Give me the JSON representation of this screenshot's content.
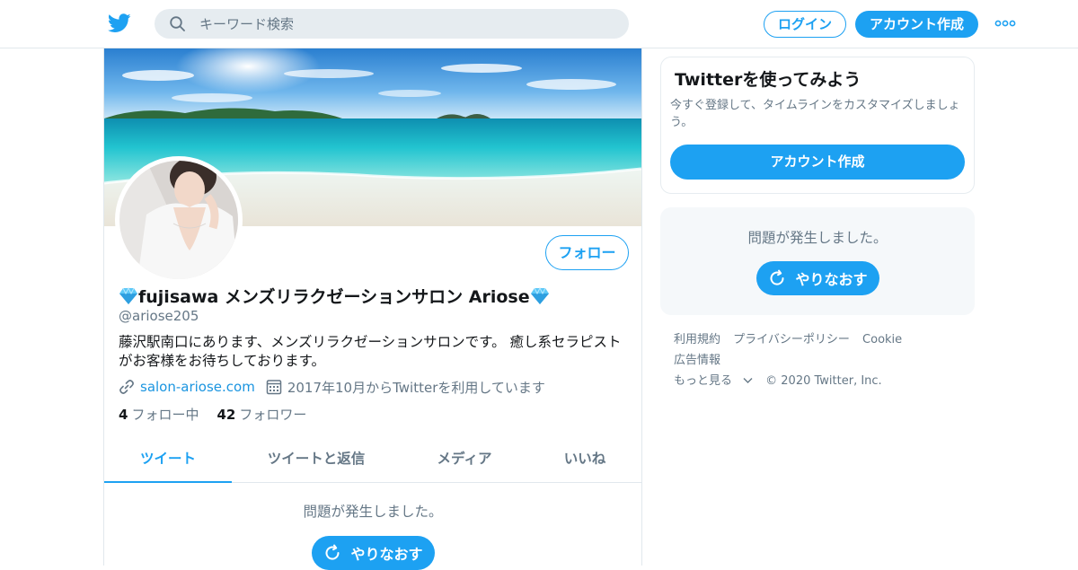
{
  "header": {
    "search_placeholder": "キーワード検索",
    "login_label": "ログイン",
    "signup_label": "アカウント作成"
  },
  "profile": {
    "display_name": "fujisawa メンズリラクゼーションサロン Ariose",
    "handle": "@ariose205",
    "bio": "藤沢駅南口にあります、メンズリラクゼーションサロンです。 癒し系セラピストがお客様をお待ちしております。",
    "website": "salon-ariose.com",
    "joined": "2017年10月からTwitterを利用しています",
    "following_count": "4",
    "following_label": "フォロー中",
    "followers_count": "42",
    "followers_label": "フォロワー",
    "follow_button": "フォロー"
  },
  "tabs": [
    {
      "label": "ツイート",
      "active": true
    },
    {
      "label": "ツイートと返信",
      "active": false
    },
    {
      "label": "メディア",
      "active": false
    },
    {
      "label": "いいね",
      "active": false
    }
  ],
  "timeline": {
    "error_message": "問題が発生しました。",
    "retry_label": "やりなおす"
  },
  "sidebar": {
    "signup_title": "Twitterを使ってみよう",
    "signup_subtitle": "今すぐ登録して、タイムラインをカスタマイズしましょう。",
    "signup_button": "アカウント作成",
    "error_message": "問題が発生しました。",
    "retry_label": "やりなおす"
  },
  "footer": {
    "links": [
      "利用規約",
      "プライバシーポリシー",
      "Cookie",
      "広告情報"
    ],
    "more": "もっと見る",
    "copyright": "© 2020 Twitter, Inc."
  },
  "colors": {
    "brand": "#1da1f2",
    "text_secondary": "#657786"
  }
}
